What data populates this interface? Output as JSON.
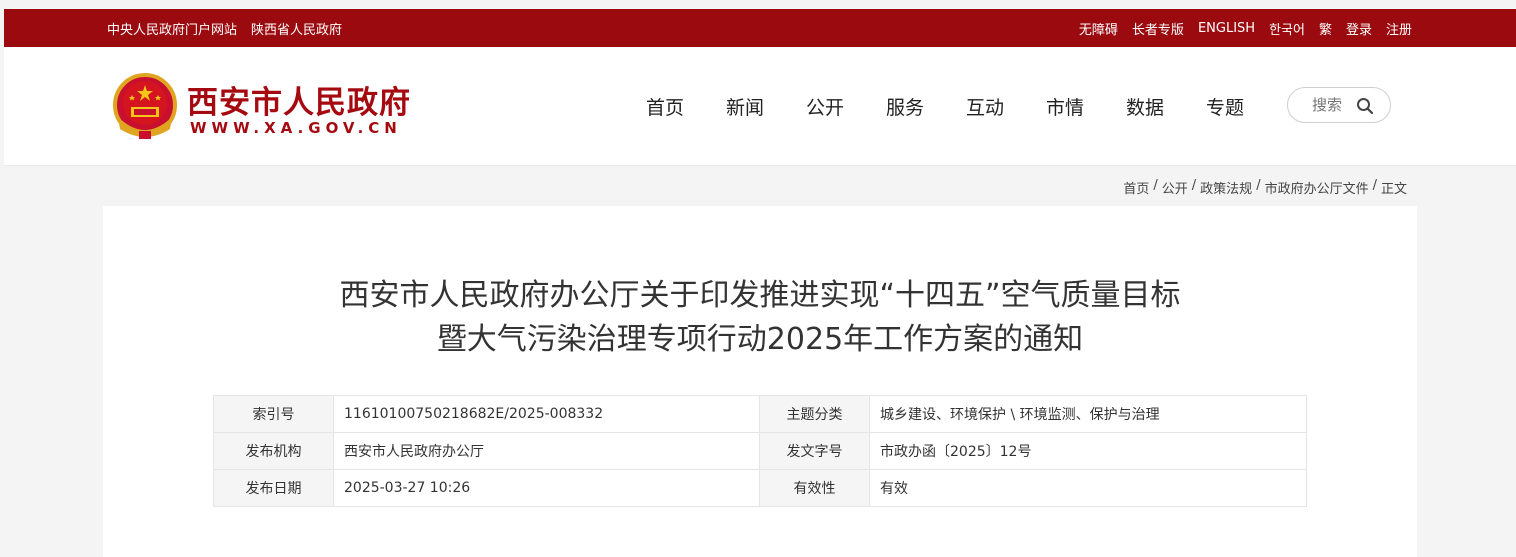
{
  "topbar": {
    "left_links": [
      "中央人民政府门户网站",
      "陕西省人民政府"
    ],
    "right_links": [
      "无障碍",
      "长者专版",
      "ENGLISH",
      "한국어",
      "繁",
      "登录",
      "注册"
    ]
  },
  "header": {
    "logo_title": "西安市人民政府",
    "logo_url": "WWW.XA.GOV.CN",
    "nav": [
      "首页",
      "新闻",
      "公开",
      "服务",
      "互动",
      "市情",
      "数据",
      "专题"
    ],
    "search_placeholder": "搜索",
    "search_icon": "search-icon",
    "emblem_icon": "national-emblem-icon"
  },
  "breadcrumb": [
    "首页",
    "公开",
    "政策法规",
    "市政府办公厅文件",
    "正文"
  ],
  "article": {
    "title_line1": "西安市人民政府办公厅关于印发推进实现“十四五”空气质量目标",
    "title_line2": "暨大气污染治理专项行动2025年工作方案的通知"
  },
  "meta": [
    {
      "k1": "索引号",
      "v1": "11610100750218682E/2025-008332",
      "k2": "主题分类",
      "v2": "城乡建设、环境保护 \\ 环境监测、保护与治理"
    },
    {
      "k1": "发布机构",
      "v1": "西安市人民政府办公厅",
      "k2": "发文字号",
      "v2": "市政办函〔2025〕12号"
    },
    {
      "k1": "发布日期",
      "v1": "2025-03-27 10:26",
      "k2": "有效性",
      "v2": "有效"
    }
  ],
  "colors": {
    "brand_red": "#9b0a0f",
    "logo_red": "#a50a10"
  }
}
